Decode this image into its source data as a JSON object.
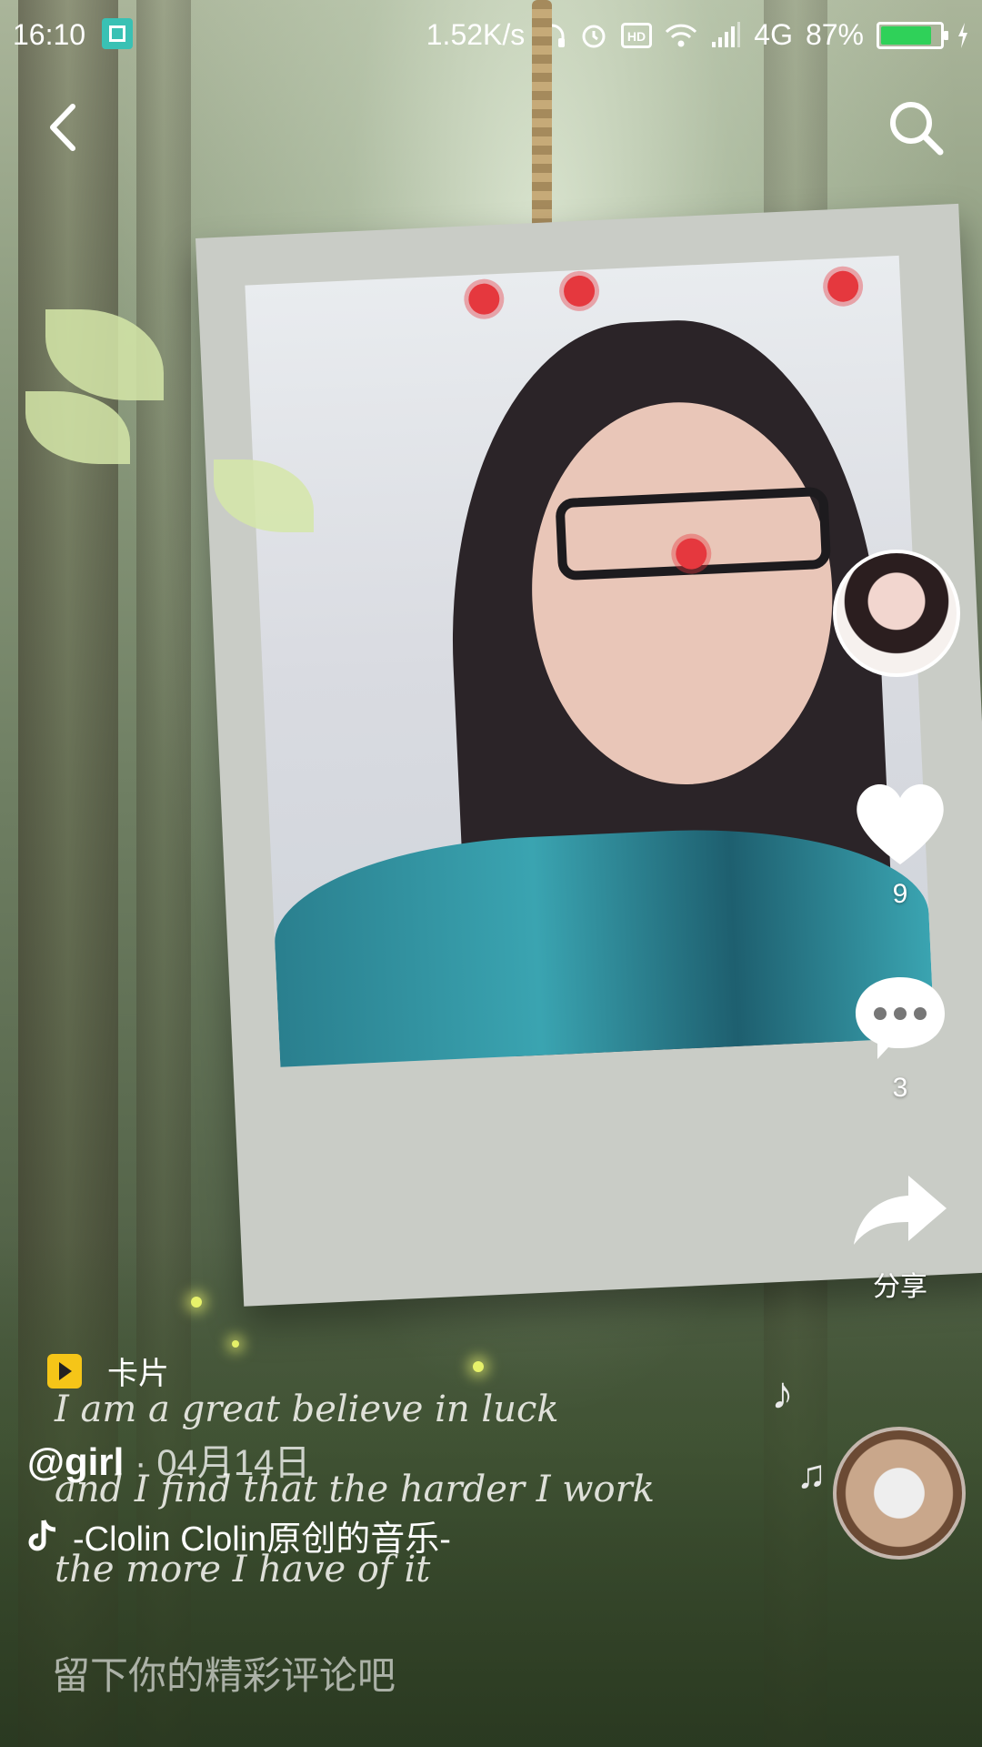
{
  "status_bar": {
    "time": "16:10",
    "network_speed": "1.52K/s",
    "network_type": "4G",
    "battery_percent": "87%",
    "battery_level": 0.87,
    "icons": [
      "scan-icon",
      "headphone-icon",
      "alarm-icon",
      "hd-icon",
      "wifi-icon",
      "signal-icon",
      "battery-icon"
    ]
  },
  "nav": {
    "back_icon": "back-arrow-icon",
    "search_icon": "search-icon"
  },
  "right_rail": {
    "like_count": "9",
    "comment_count": "3",
    "share_label": "分享"
  },
  "lyrics": [
    "I am a great believe in luck",
    "and I find that the harder I work",
    "the more I have of it"
  ],
  "post": {
    "card_label": "卡片",
    "author": "@girl",
    "date": "· 04月14日",
    "music": "-Clolin    Clolin原创的音乐-"
  },
  "comment_box": {
    "placeholder": "留下你的精彩评论吧"
  },
  "colors": {
    "battery_green": "#2fd159",
    "card_badge": "#f5c518",
    "scan_badge": "#39c1b4"
  }
}
